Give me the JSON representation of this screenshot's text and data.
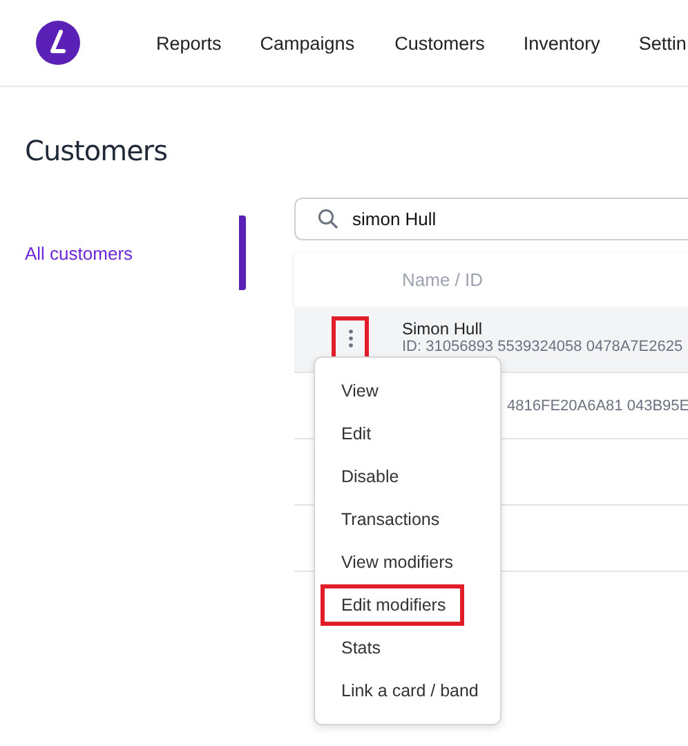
{
  "nav": [
    {
      "label": "Reports"
    },
    {
      "label": "Campaigns"
    },
    {
      "label": "Customers"
    },
    {
      "label": "Inventory"
    },
    {
      "label": "Settin"
    }
  ],
  "page_title": "Customers",
  "sidebar": {
    "items": [
      {
        "label": "All customers",
        "selected": true
      }
    ]
  },
  "search": {
    "value": "simon Hull"
  },
  "table": {
    "columns": [
      "Name / ID"
    ],
    "rows": [
      {
        "kind": "full",
        "selected": true,
        "name": "Simon Hull",
        "id": "ID: 31056893 5539324058 0478A7E2625"
      },
      {
        "kind": "covered",
        "selected": false,
        "id": "4816FE20A6A81 043B95E"
      },
      {
        "kind": "empty",
        "selected": false
      },
      {
        "kind": "empty",
        "selected": false
      }
    ]
  },
  "row_menu_button": {
    "highlighted": true
  },
  "context_menu": {
    "items": [
      {
        "label": "View",
        "highlighted": false
      },
      {
        "label": "Edit",
        "highlighted": false
      },
      {
        "label": "Disable",
        "highlighted": false
      },
      {
        "label": "Transactions",
        "highlighted": false
      },
      {
        "label": "View modifiers",
        "highlighted": false
      },
      {
        "label": "Edit modifiers",
        "highlighted": true
      },
      {
        "label": "Stats",
        "highlighted": false
      },
      {
        "label": "Link a card / band",
        "highlighted": false
      }
    ]
  }
}
